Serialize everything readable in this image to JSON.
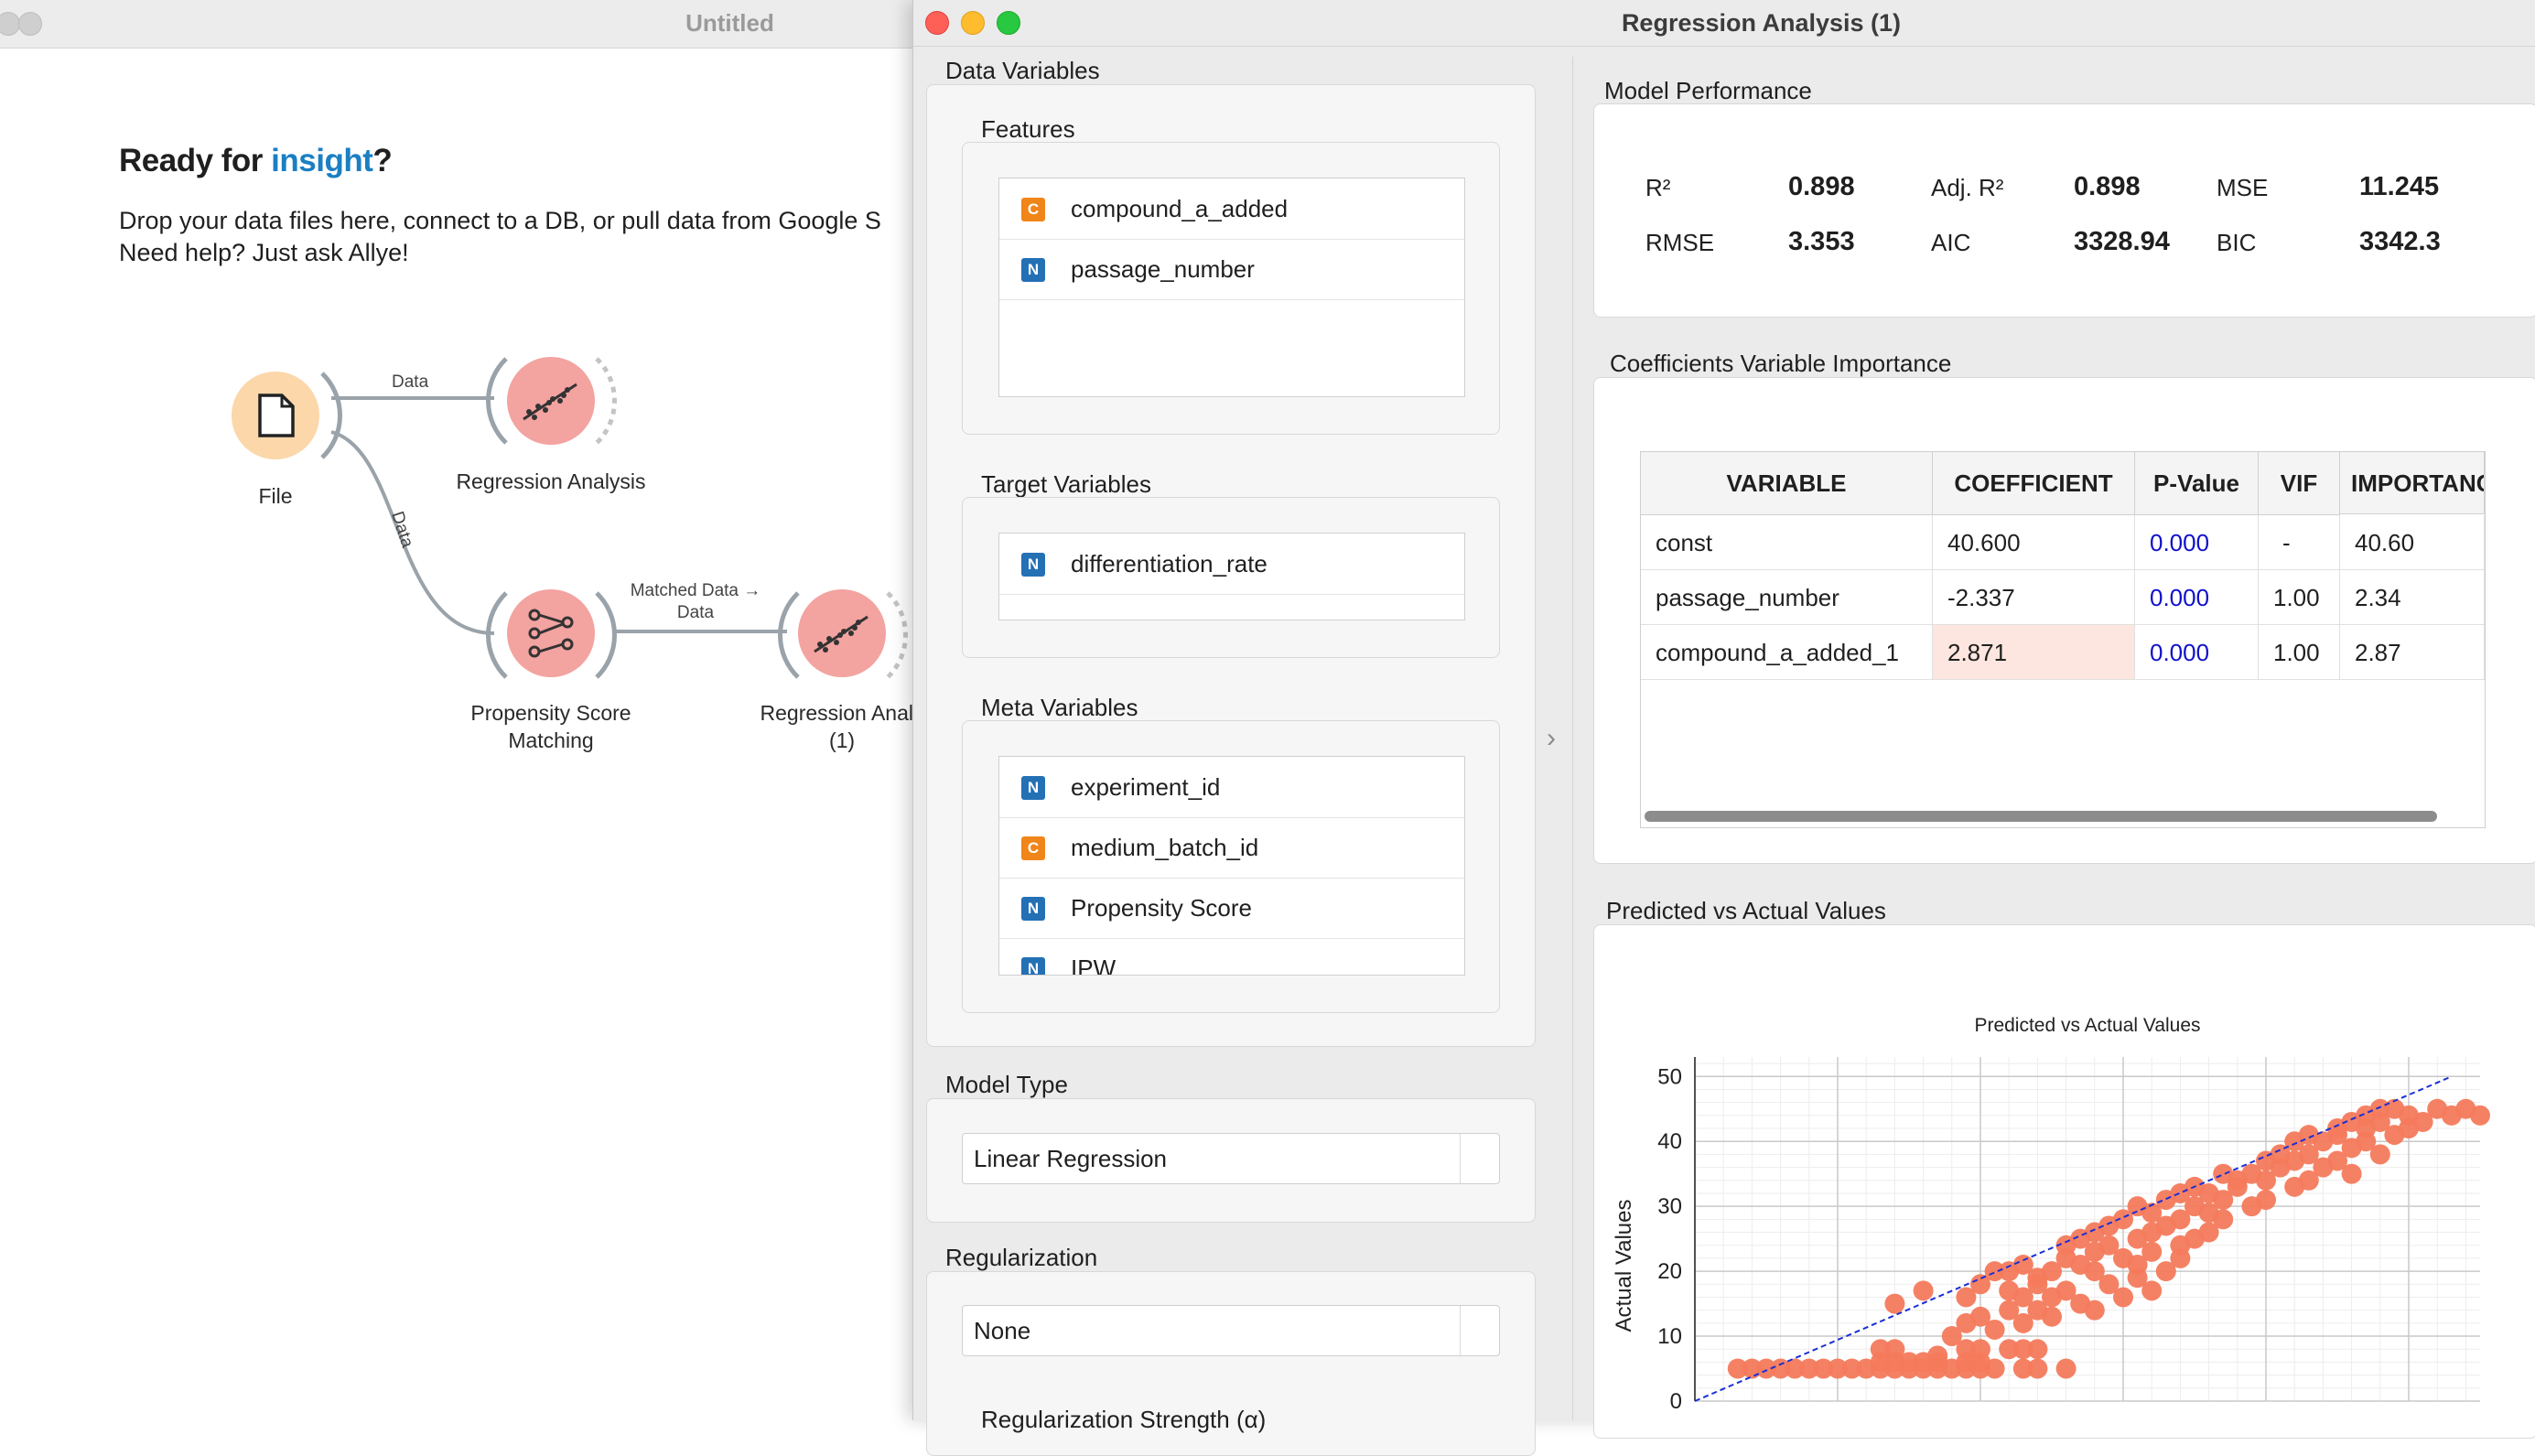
{
  "back_window": {
    "title": "Untitled",
    "hero_prefix": "Ready for ",
    "hero_highlight": "insight",
    "hero_suffix": "?",
    "line1": "Drop your data files here, connect to a DB, or pull data from Google S",
    "line2": "Need help? Just ask Allye!",
    "nodes": [
      {
        "label": "File",
        "icon": "file-icon"
      },
      {
        "label": "Regression Analysis",
        "icon": "regression-icon"
      },
      {
        "label_lines": [
          "Propensity Score",
          "Matching"
        ],
        "icon": "matching-icon"
      },
      {
        "label_lines": [
          "Regression Analy",
          "(1)"
        ],
        "icon": "regression-icon"
      }
    ],
    "links": {
      "file_to_regression": "Data",
      "file_to_psm": "Data",
      "psm_to_regression_line1": "Matched Data →",
      "psm_to_regression_line2": "Data"
    }
  },
  "front_window": {
    "title": "Regression Analysis (1)",
    "data_variables_label": "Data Variables",
    "features": {
      "label": "Features",
      "items": [
        {
          "type": "C",
          "name": "compound_a_added"
        },
        {
          "type": "N",
          "name": "passage_number"
        }
      ]
    },
    "target": {
      "label": "Target Variables",
      "items": [
        {
          "type": "N",
          "name": "differentiation_rate"
        }
      ]
    },
    "meta": {
      "label": "Meta Variables",
      "items": [
        {
          "type": "N",
          "name": "experiment_id"
        },
        {
          "type": "C",
          "name": "medium_batch_id"
        },
        {
          "type": "N",
          "name": "Propensity Score"
        },
        {
          "type": "N",
          "name": "IPW"
        }
      ]
    },
    "model_type": {
      "label": "Model Type",
      "value": "Linear Regression"
    },
    "regularization": {
      "label": "Regularization",
      "value": "None",
      "strength_label": "Regularization Strength (α)"
    },
    "model_performance": {
      "label": "Model Performance",
      "metrics": [
        {
          "name": "R²",
          "value": "0.898"
        },
        {
          "name": "Adj. R²",
          "value": "0.898"
        },
        {
          "name": "MSE",
          "value": "11.245"
        },
        {
          "name": "RMSE",
          "value": "3.353"
        },
        {
          "name": "AIC",
          "value": "3328.94"
        },
        {
          "name": "BIC",
          "value": "3342.3"
        }
      ]
    },
    "coefficients": {
      "tabs_label": "Coefficients  Variable Importance",
      "headers": [
        "VARIABLE",
        "COEFFICIENT",
        "P-Value",
        "VIF",
        "IMPORTANC"
      ],
      "rows": [
        [
          "const",
          "40.600",
          "0.000",
          "-",
          "40.60"
        ],
        [
          "passage_number",
          "-2.337",
          "0.000",
          "1.00",
          "2.34"
        ],
        [
          "compound_a_added_1",
          "2.871",
          "0.000",
          "1.00",
          "2.87"
        ]
      ]
    },
    "predicted_label": "Predicted vs Actual Values"
  },
  "chart_data": {
    "type": "scatter",
    "title": "Predicted vs Actual Values",
    "ylabel": "Actual Values",
    "xlabel": "",
    "ylim": [
      0,
      53
    ],
    "xlim": [
      0,
      55
    ],
    "yticks": [
      "0",
      "10",
      "20",
      "30",
      "40",
      "50"
    ],
    "grid": true,
    "point_color": "#f47a5c",
    "reference_line_color": "#1a2fd6",
    "reference_line": [
      [
        0,
        0
      ],
      [
        53,
        50
      ]
    ],
    "points": [
      [
        3,
        5
      ],
      [
        4,
        5
      ],
      [
        5,
        5
      ],
      [
        6,
        5
      ],
      [
        7,
        5
      ],
      [
        8,
        5
      ],
      [
        9,
        5
      ],
      [
        10,
        5
      ],
      [
        11,
        5
      ],
      [
        12,
        5
      ],
      [
        13,
        5
      ],
      [
        14,
        5
      ],
      [
        15,
        5
      ],
      [
        16,
        5
      ],
      [
        17,
        5
      ],
      [
        18,
        5
      ],
      [
        19,
        5
      ],
      [
        20,
        5
      ],
      [
        21,
        5
      ],
      [
        23,
        5
      ],
      [
        24,
        5
      ],
      [
        26,
        5
      ],
      [
        13,
        6
      ],
      [
        14,
        6
      ],
      [
        15,
        6
      ],
      [
        16,
        6
      ],
      [
        17,
        6
      ],
      [
        19,
        6
      ],
      [
        20,
        6
      ],
      [
        13,
        8
      ],
      [
        14,
        8
      ],
      [
        17,
        7
      ],
      [
        19,
        8
      ],
      [
        20,
        8
      ],
      [
        22,
        8
      ],
      [
        23,
        8
      ],
      [
        24,
        8
      ],
      [
        14,
        15
      ],
      [
        16,
        17
      ],
      [
        18,
        10
      ],
      [
        19,
        12
      ],
      [
        20,
        13
      ],
      [
        21,
        11
      ],
      [
        22,
        14
      ],
      [
        23,
        12
      ],
      [
        24,
        14
      ],
      [
        25,
        13
      ],
      [
        19,
        16
      ],
      [
        20,
        18
      ],
      [
        21,
        20
      ],
      [
        22,
        17
      ],
      [
        23,
        16
      ],
      [
        24,
        18
      ],
      [
        25,
        16
      ],
      [
        26,
        17
      ],
      [
        27,
        15
      ],
      [
        28,
        14
      ],
      [
        22,
        20
      ],
      [
        23,
        21
      ],
      [
        24,
        19
      ],
      [
        25,
        20
      ],
      [
        26,
        22
      ],
      [
        27,
        21
      ],
      [
        28,
        20
      ],
      [
        29,
        18
      ],
      [
        30,
        16
      ],
      [
        31,
        19
      ],
      [
        32,
        17
      ],
      [
        26,
        24
      ],
      [
        27,
        25
      ],
      [
        28,
        23
      ],
      [
        29,
        24
      ],
      [
        30,
        22
      ],
      [
        31,
        21
      ],
      [
        32,
        23
      ],
      [
        33,
        20
      ],
      [
        34,
        22
      ],
      [
        28,
        26
      ],
      [
        29,
        27
      ],
      [
        30,
        28
      ],
      [
        31,
        25
      ],
      [
        32,
        26
      ],
      [
        33,
        27
      ],
      [
        34,
        24
      ],
      [
        35,
        25
      ],
      [
        36,
        26
      ],
      [
        31,
        30
      ],
      [
        32,
        29
      ],
      [
        33,
        31
      ],
      [
        34,
        28
      ],
      [
        35,
        30
      ],
      [
        36,
        29
      ],
      [
        37,
        28
      ],
      [
        34,
        32
      ],
      [
        35,
        33
      ],
      [
        36,
        32
      ],
      [
        37,
        31
      ],
      [
        38,
        33
      ],
      [
        39,
        30
      ],
      [
        40,
        31
      ],
      [
        37,
        35
      ],
      [
        38,
        34
      ],
      [
        39,
        35
      ],
      [
        40,
        34
      ],
      [
        41,
        36
      ],
      [
        42,
        33
      ],
      [
        43,
        34
      ],
      [
        40,
        37
      ],
      [
        41,
        38
      ],
      [
        42,
        37
      ],
      [
        43,
        38
      ],
      [
        44,
        36
      ],
      [
        45,
        37
      ],
      [
        46,
        35
      ],
      [
        42,
        40
      ],
      [
        43,
        41
      ],
      [
        44,
        40
      ],
      [
        45,
        41
      ],
      [
        46,
        39
      ],
      [
        47,
        40
      ],
      [
        48,
        38
      ],
      [
        45,
        42
      ],
      [
        46,
        43
      ],
      [
        47,
        42
      ],
      [
        48,
        43
      ],
      [
        49,
        41
      ],
      [
        50,
        42
      ],
      [
        47,
        44
      ],
      [
        48,
        45
      ],
      [
        49,
        45
      ],
      [
        50,
        44
      ],
      [
        51,
        43
      ],
      [
        52,
        45
      ],
      [
        53,
        44
      ],
      [
        54,
        45
      ],
      [
        55,
        44
      ]
    ]
  }
}
